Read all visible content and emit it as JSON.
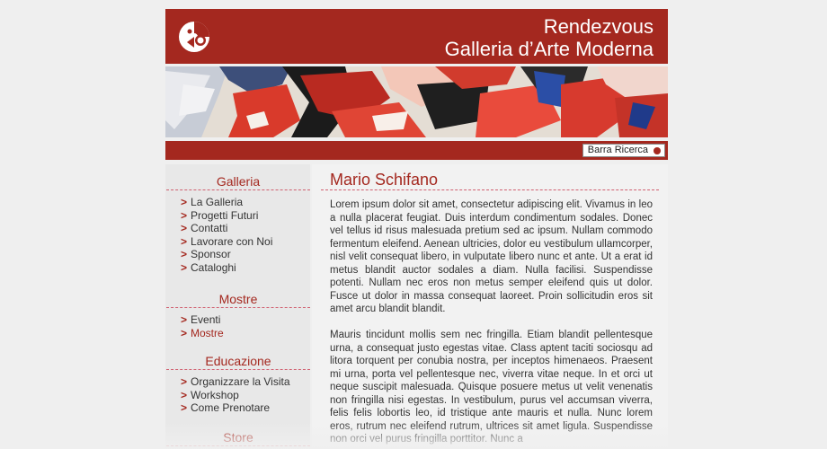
{
  "header": {
    "title_line1": "Rendezvous",
    "title_line2": "Galleria d’Arte Moderna",
    "logo_icon": "logo-icon"
  },
  "searchbar": {
    "button_label": "Barra Ricerca",
    "button_icon": "dot-icon"
  },
  "sidebar": {
    "sections": [
      {
        "title": "Galleria",
        "items": [
          "La Galleria",
          "Progetti Futuri",
          "Contatti",
          "Lavorare con Noi",
          "Sponsor",
          "Cataloghi"
        ]
      },
      {
        "title": "Mostre",
        "items": [
          "Eventi",
          "Mostre"
        ],
        "active_item": "Mostre"
      },
      {
        "title": "Educazione",
        "items": [
          "Organizzare la Visita",
          "Workshop",
          "Come Prenotare"
        ]
      },
      {
        "title": "Store",
        "items": []
      }
    ],
    "arrow_glyph": ">"
  },
  "content": {
    "heading": "Mario Schifano",
    "paragraph1": "Lorem ipsum dolor sit amet, consectetur adipiscing elit. Vivamus in leo a nulla placerat feugiat. Duis interdum condimentum sodales. Donec vel tellus id risus malesuada pretium sed ac ipsum. Nullam commodo fermentum eleifend. Aenean ultricies, dolor eu vestibulum ullamcorper, nisl velit consequat libero, in vulputate libero nunc et ante. Ut a erat id metus blandit auctor sodales a diam. Nulla facilisi. Suspendisse potenti. Nullam nec eros non metus semper eleifend quis ut dolor. Fusce ut dolor in massa consequat laoreet. Proin sollicitudin eros sit amet arcu blandit blandit.",
    "paragraph2": "Mauris tincidunt mollis sem nec fringilla. Etiam blandit pellentesque urna, a consequat justo egestas vitae. Class aptent taciti sociosqu ad litora torquent per conubia nostra, per inceptos himenaeos. Praesent mi urna, porta vel pellentesque nec, viverra vitae neque. In et orci ut neque suscipit malesuada. Quisque posuere metus ut velit venenatis non fringilla nisi egestas. In vestibulum, purus vel accumsan viverra, felis felis lobortis leo, id tristique ante mauris et nulla. Nunc lorem eros, rutrum nec eleifend rutrum, ultrices sit amet ligula. Suspendisse non orci vel purus fringilla porttitor. Nunc a"
  },
  "colors": {
    "brand_red": "#a4281f",
    "background": "#efefef",
    "sidebar_bg": "#e8e8e8"
  }
}
